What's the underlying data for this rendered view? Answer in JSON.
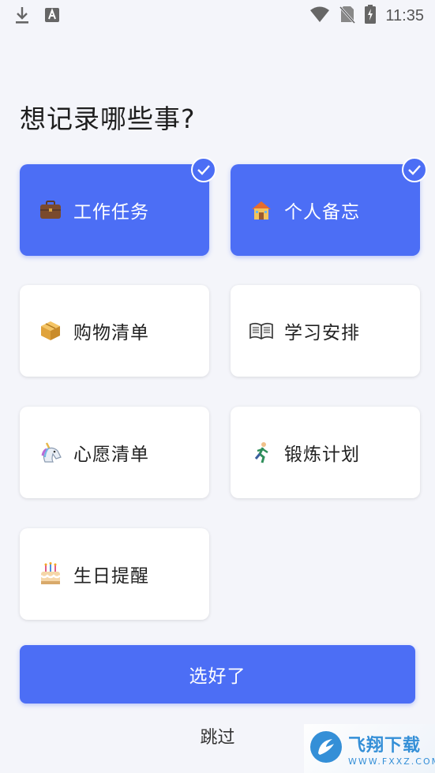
{
  "status_bar": {
    "time": "11:35",
    "icons": [
      "download-icon",
      "a-box-icon",
      "wifi-icon",
      "no-sim-icon",
      "battery-charging-icon"
    ]
  },
  "page": {
    "title": "想记录哪些事?"
  },
  "options": [
    {
      "label": "工作任务",
      "icon": "briefcase-icon",
      "selected": true
    },
    {
      "label": "个人备忘",
      "icon": "house-icon",
      "selected": true
    },
    {
      "label": "购物清单",
      "icon": "package-icon",
      "selected": false
    },
    {
      "label": "学习安排",
      "icon": "open-book-icon",
      "selected": false
    },
    {
      "label": "心愿清单",
      "icon": "unicorn-icon",
      "selected": false
    },
    {
      "label": "锻炼计划",
      "icon": "runner-icon",
      "selected": false
    },
    {
      "label": "生日提醒",
      "icon": "birthday-cake-icon",
      "selected": false
    }
  ],
  "actions": {
    "confirm_label": "选好了",
    "skip_label": "跳过"
  },
  "watermark": {
    "title": "飞翔下载",
    "url": "WWW.FXXZ.COM"
  },
  "colors": {
    "accent": "#4c6ef5",
    "background": "#f4f5fa",
    "card": "#ffffff"
  }
}
